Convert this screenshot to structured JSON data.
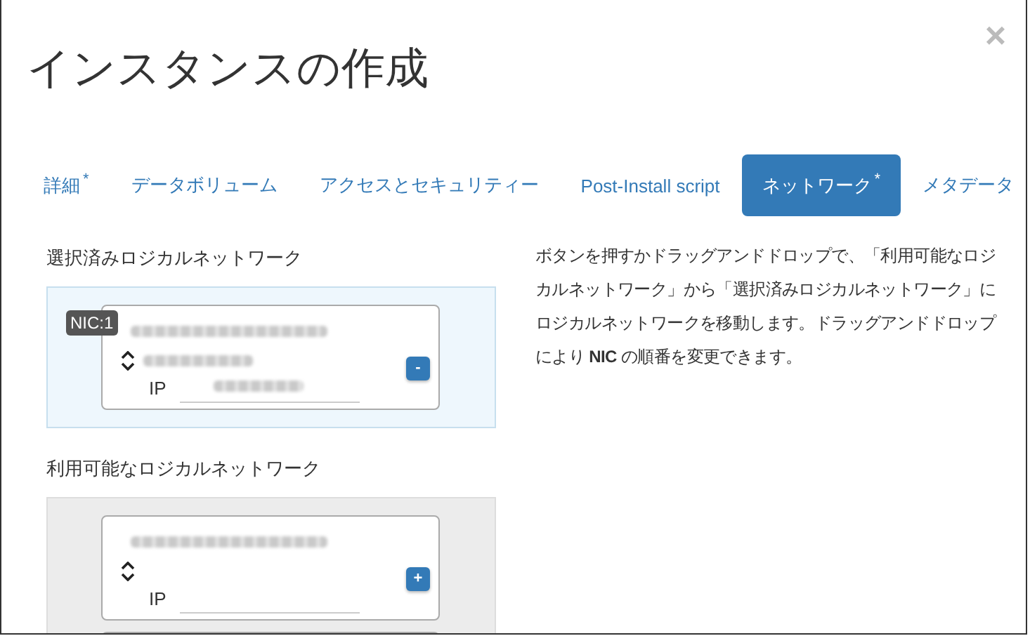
{
  "modal": {
    "title": "インスタンスの作成",
    "close": "×"
  },
  "tabs": [
    {
      "label": "詳細",
      "required": true,
      "selected": false
    },
    {
      "label": "データボリューム",
      "required": false,
      "selected": false
    },
    {
      "label": "アクセスとセキュリティー",
      "required": false,
      "selected": false
    },
    {
      "label": "Post-Install script",
      "required": false,
      "selected": false
    },
    {
      "label": "ネットワーク",
      "required": true,
      "selected": true
    },
    {
      "label": "メタデータ",
      "required": false,
      "selected": false
    }
  ],
  "required_mark": "*",
  "selected_networks": {
    "heading": "選択済みロジカルネットワーク",
    "items": [
      {
        "kind": "full",
        "badge": "NIC:1",
        "ip_label": "IP",
        "button": "-"
      }
    ]
  },
  "available_networks": {
    "heading": "利用可能なロジカルネットワーク",
    "items": [
      {
        "kind": "full",
        "ip_label": "IP",
        "button": "+"
      },
      {
        "kind": "cut_off"
      }
    ]
  },
  "help_text": "ボタンを押すかドラッグアンドドロップで、「利用可能なロジカルネットワーク」から「選択済みロジカルネットワーク」にロジカルネットワークを移動します。ドラッグアンドドロップにより **NIC** の順番を変更できます。"
}
